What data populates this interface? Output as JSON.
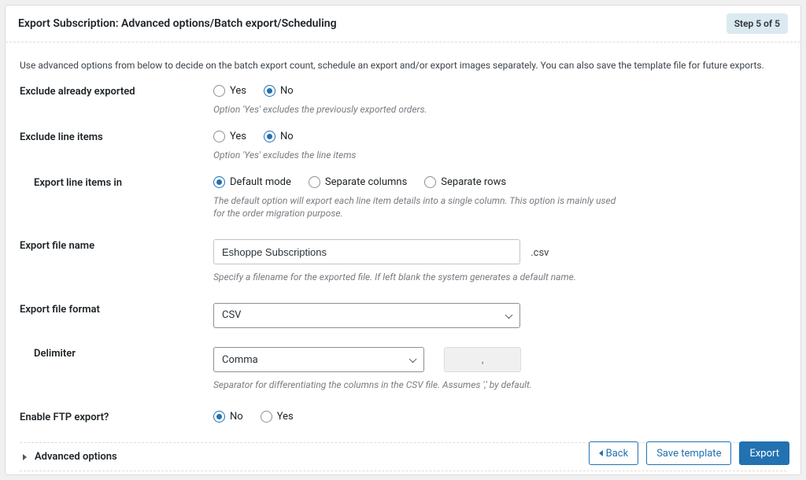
{
  "header": {
    "title": "Export Subscription: Advanced options/Batch export/Scheduling",
    "step_badge": "Step 5 of 5"
  },
  "intro": "Use advanced options from below to decide on the batch export count, schedule an export and/or export images separately. You can also save the template file for future exports.",
  "fields": {
    "exclude_exported": {
      "label": "Exclude already exported",
      "options": {
        "yes": "Yes",
        "no": "No"
      },
      "selected": "no",
      "hint": "Option 'Yes' excludes the previously exported orders."
    },
    "exclude_line_items": {
      "label": "Exclude line items",
      "options": {
        "yes": "Yes",
        "no": "No"
      },
      "selected": "no",
      "hint": "Option 'Yes' excludes the line items"
    },
    "export_line_items_in": {
      "label": "Export line items in",
      "options": {
        "default": "Default mode",
        "cols": "Separate columns",
        "rows": "Separate rows"
      },
      "selected": "default",
      "hint": "The default option will export each line item details into a single column. This option is mainly used for the order migration purpose."
    },
    "export_file_name": {
      "label": "Export file name",
      "value": "Eshoppe Subscriptions",
      "ext": ".csv",
      "hint": "Specify a filename for the exported file. If left blank the system generates a default name."
    },
    "export_file_format": {
      "label": "Export file format",
      "value": "CSV"
    },
    "delimiter": {
      "label": "Delimiter",
      "value": "Comma",
      "char": ",",
      "hint": "Separator for differentiating the columns in the CSV file. Assumes ',' by default."
    },
    "enable_ftp": {
      "label": "Enable FTP export?",
      "options": {
        "no": "No",
        "yes": "Yes"
      },
      "selected": "no"
    }
  },
  "advanced_section": {
    "label": "Advanced options"
  },
  "footer": {
    "back": "Back",
    "save_template": "Save template",
    "export": "Export"
  }
}
